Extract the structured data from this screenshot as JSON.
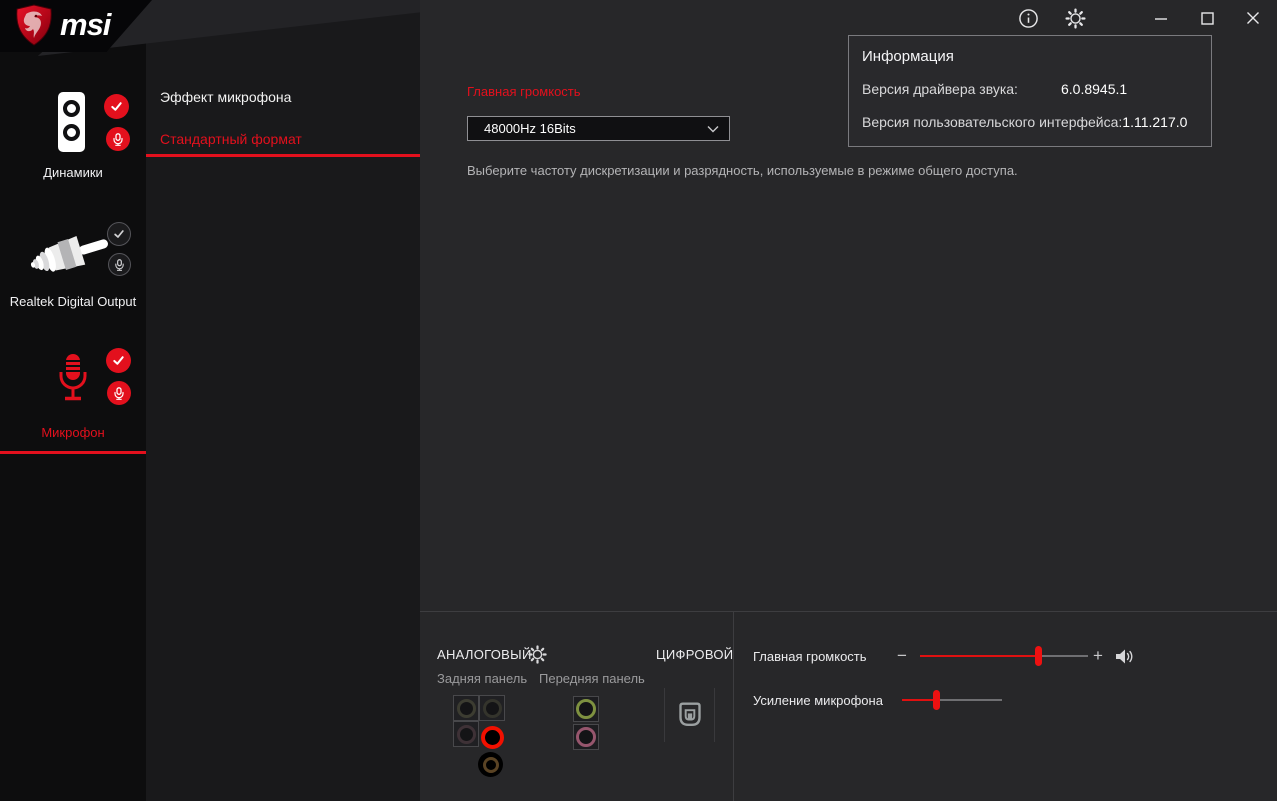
{
  "brand": {
    "logo_text": "msi"
  },
  "titlebar": {
    "icons": [
      "info",
      "settings",
      "minimize",
      "maximize",
      "close"
    ]
  },
  "sidebar": {
    "devices": [
      {
        "label": "Динамики",
        "selected": false,
        "badges": [
          "check",
          "mic"
        ],
        "badge_style": "red"
      },
      {
        "label": "Realtek Digital Output",
        "selected": false,
        "badges": [
          "check",
          "mic"
        ],
        "badge_style": "dark"
      },
      {
        "label": "Микрофон",
        "selected": true,
        "badges": [
          "check",
          "mic"
        ],
        "badge_style": "red"
      }
    ]
  },
  "menu": {
    "items": [
      {
        "label": "Эффект микрофона",
        "selected": false
      },
      {
        "label": "Стандартный формат",
        "selected": true
      }
    ]
  },
  "format_section": {
    "title": "Главная громкость",
    "format_value": "48000Hz 16Bits",
    "description": "Выберите частоту дискретизации и разрядность, используемые в режиме общего доступа."
  },
  "info_panel": {
    "title": "Информация",
    "rows": [
      {
        "label": "Версия драйвера звука:",
        "value": "6.0.8945.1"
      },
      {
        "label": "Версия пользовательского интерфейса:",
        "value": "1.11.217.0"
      }
    ]
  },
  "jack_panel": {
    "analog_label": "АНАЛОГОВЫЙ",
    "digital_label": "ЦИФРОВОЙ",
    "rear_label": "Задняя панель",
    "front_label": "Передняя панель",
    "rear_jacks": [
      {
        "name": "rear-jack-1",
        "color": "#3c3c31",
        "active": false
      },
      {
        "name": "rear-jack-2",
        "color": "#34342c",
        "active": false
      },
      {
        "name": "rear-jack-3",
        "color": "#3e3136",
        "active": false
      },
      {
        "name": "rear-jack-mic",
        "color": "#f21000",
        "active": true
      },
      {
        "name": "rear-jack-5",
        "color": "#5a4324",
        "active": false
      }
    ],
    "front_jacks": [
      {
        "name": "front-jack-headphone",
        "color": "#7e9140",
        "active": false
      },
      {
        "name": "front-jack-mic",
        "color": "#96566d",
        "active": false
      }
    ]
  },
  "sliders": [
    {
      "label": "Главная громкость",
      "percent": 70,
      "has_buttons": true,
      "has_speaker_icon": true
    },
    {
      "label": "Усиление микрофона",
      "percent": 34,
      "has_buttons": false,
      "has_speaker_icon": false
    }
  ],
  "slider_buttons": {
    "minus": "−",
    "plus": "+"
  },
  "colors": {
    "accent_red": "#e3101d",
    "slider_red": "#ee1111",
    "active_jack_red": "#f21000",
    "front_green": "#7e9140",
    "front_pink": "#96566d",
    "main_bg": "#272729",
    "sidebar_bg": "#0d0d0e",
    "menu_bg": "#19191b",
    "panel_bg": "#29292c"
  }
}
